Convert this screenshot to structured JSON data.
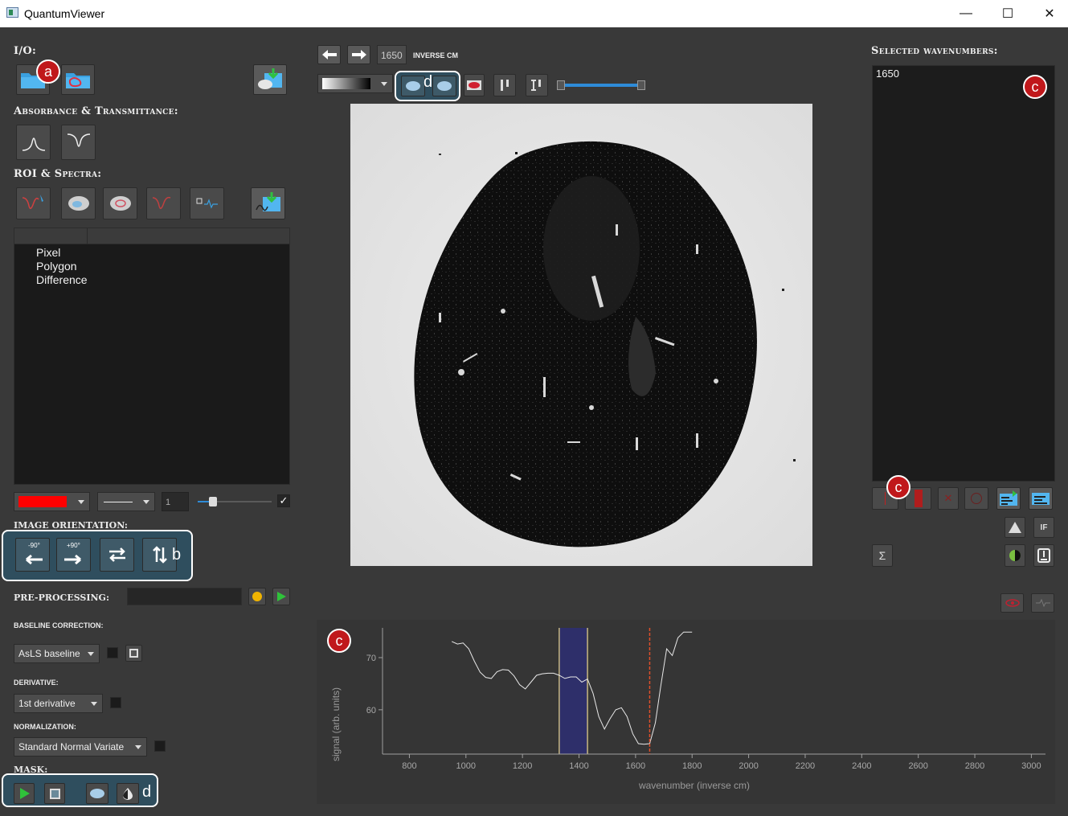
{
  "window": {
    "title": "QuantumViewer",
    "minimize": "—",
    "maximize": "☐",
    "close": "✕"
  },
  "io": {
    "heading": "I/O:"
  },
  "absorbance": {
    "heading": "Absorbance & Transmittance:"
  },
  "roi": {
    "heading": "ROI & Spectra:",
    "items": [
      "Pixel",
      "Polygon",
      "Difference"
    ],
    "line_width": "1"
  },
  "orientation": {
    "heading": "Image orientation:",
    "rotate_left": "-90°",
    "rotate_right": "+90°"
  },
  "preprocessing": {
    "heading": "Pre-processing:",
    "status_color": "#f0b400"
  },
  "baseline": {
    "heading": "Baseline correction:",
    "value": "AsLS baseline"
  },
  "derivative": {
    "heading": "Derivative:",
    "value": "1st derivative"
  },
  "normalization": {
    "heading": "Normalization:",
    "value": "Standard Normal Variate"
  },
  "mask": {
    "heading": "Mask:"
  },
  "toolbar": {
    "wavenumber": "1650",
    "unit": "INVERSE CM"
  },
  "selected": {
    "heading": "Selected wavenumbers:",
    "items": [
      "1650"
    ]
  },
  "annotations": {
    "a": "a",
    "b": "b",
    "c": "c",
    "d": "d"
  },
  "colors": {
    "roi_color": "#ff0000",
    "accent": "#2e8bd8",
    "annotation_red": "#c0181b"
  },
  "chart_data": {
    "type": "line",
    "xlabel": "wavenumber (inverse cm)",
    "ylabel": "signal (arb. units)",
    "xlim": [
      705,
      3050
    ],
    "ylim": [
      51.5,
      75.7
    ],
    "xticks": [
      800,
      1000,
      1200,
      1400,
      1600,
      1800,
      2000,
      2200,
      2400,
      2600,
      2800,
      3000
    ],
    "yticks": [
      60,
      70
    ],
    "series": [
      {
        "x": [
          950,
          970,
          990,
          1010,
          1030,
          1050,
          1070,
          1090,
          1110,
          1130,
          1150,
          1170,
          1190,
          1210,
          1230,
          1250,
          1270,
          1290,
          1310,
          1330,
          1350,
          1370,
          1390,
          1410,
          1430,
          1450,
          1470,
          1490,
          1510,
          1530,
          1550,
          1570,
          1590,
          1610,
          1630,
          1650,
          1670,
          1690,
          1710,
          1730,
          1750,
          1770,
          1800
        ],
        "y": [
          73.1,
          72.6,
          72.8,
          71.7,
          69.3,
          67.2,
          66.2,
          66.0,
          67.3,
          67.7,
          67.6,
          66.5,
          64.8,
          64.0,
          65.3,
          66.6,
          66.9,
          67.0,
          67.0,
          66.6,
          66.0,
          66.3,
          66.3,
          65.3,
          65.9,
          63.1,
          58.7,
          56.3,
          58.3,
          60.0,
          60.4,
          58.7,
          55.4,
          53.5,
          53.4,
          53.5,
          57.5,
          64.8,
          71.7,
          70.4,
          73.8,
          74.9,
          74.9
        ]
      }
    ],
    "band": [
      1330,
      1430
    ],
    "markers": [
      1650
    ]
  }
}
